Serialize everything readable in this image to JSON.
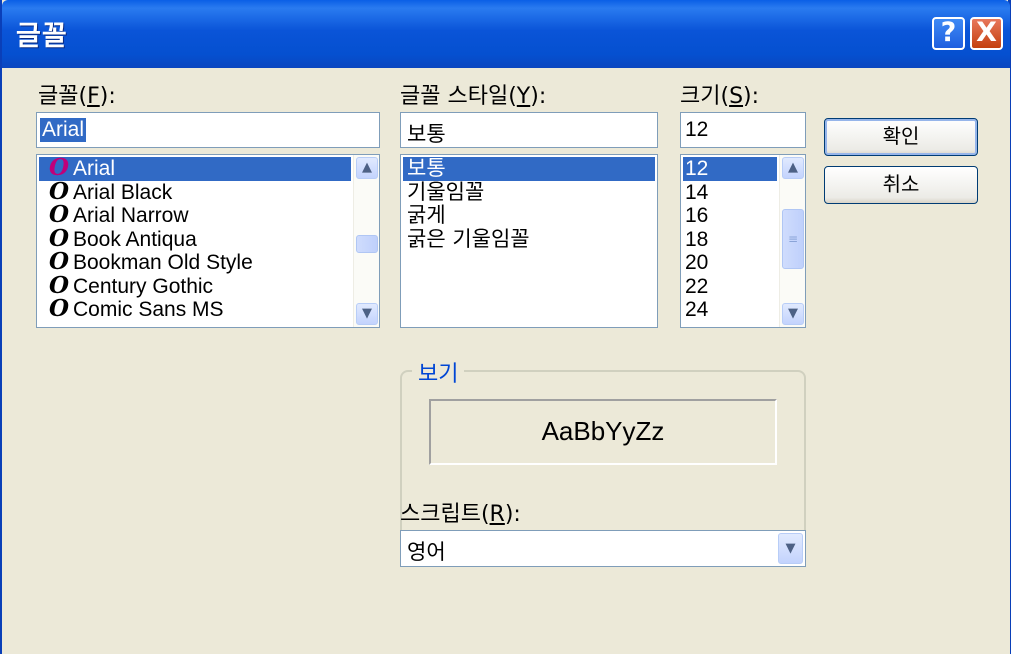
{
  "window": {
    "title": "글꼴",
    "help_glyph": "?",
    "close_glyph": "X"
  },
  "font": {
    "label_prefix": "글꼴(",
    "label_key": "F",
    "label_suffix": "):",
    "value": "Arial",
    "items": [
      "Arial",
      "Arial Black",
      "Arial Narrow",
      "Book Antiqua",
      "Bookman Old Style",
      "Century Gothic",
      "Comic Sans MS"
    ],
    "item_icon": "opentype-font-icon",
    "icon_glyph": "O",
    "selected_index": 0
  },
  "style": {
    "label_prefix": "글꼴 스타일(",
    "label_key": "Y",
    "label_suffix": "):",
    "value": "보통",
    "items": [
      "보통",
      "기울임꼴",
      "굵게",
      "굵은 기울임꼴"
    ],
    "selected_index": 0
  },
  "size": {
    "label_prefix": "크기(",
    "label_key": "S",
    "label_suffix": "):",
    "value": "12",
    "items": [
      "12",
      "14",
      "16",
      "18",
      "20",
      "22",
      "24"
    ],
    "selected_index": 0
  },
  "buttons": {
    "ok": "확인",
    "cancel": "취소"
  },
  "preview": {
    "label": "보기",
    "sample": "AaBbYyZz"
  },
  "script": {
    "label_prefix": "스크립트(",
    "label_key": "R",
    "label_suffix": "):",
    "value": "영어"
  },
  "colors": {
    "titlebar": "#0a54d8",
    "selection": "#316ac5",
    "dialog_bg": "#ece9d8",
    "group_label": "#0046d5"
  }
}
